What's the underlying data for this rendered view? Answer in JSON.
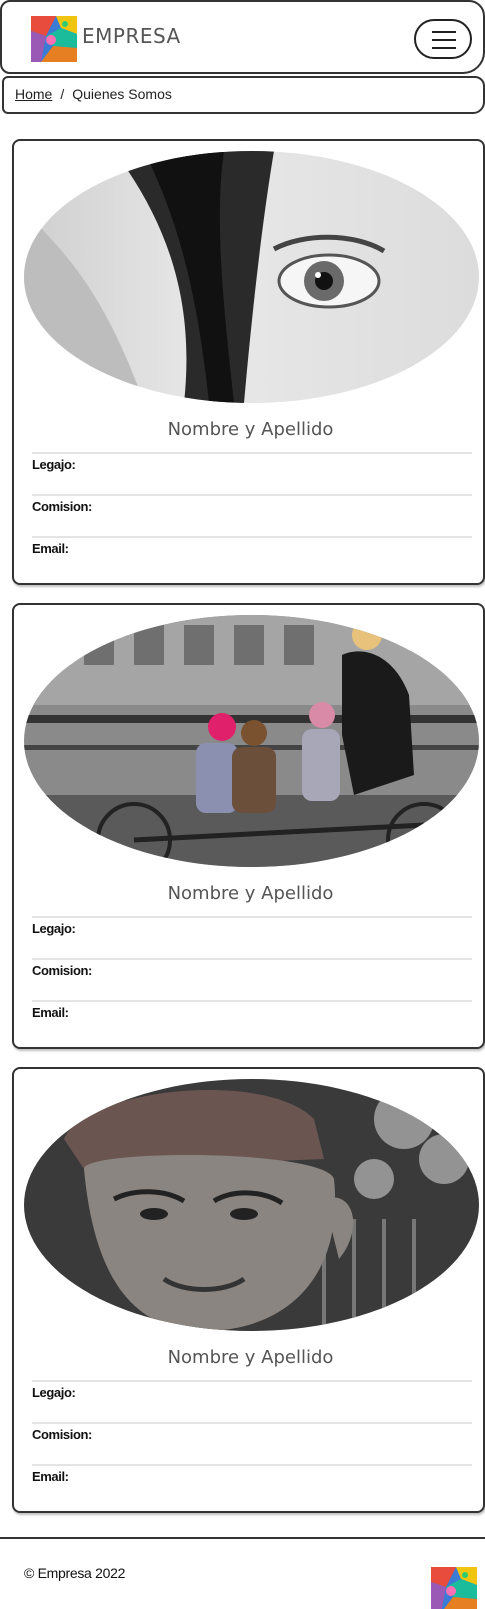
{
  "navbar": {
    "brand_name": "EMPRESA",
    "logo_icon": "abstract-paint-logo",
    "menu_icon": "hamburger-menu-icon"
  },
  "breadcrumb": {
    "home_label": "Home",
    "separator": "/",
    "current_label": "Quienes Somos"
  },
  "team": [
    {
      "name": "Nombre y Apellido",
      "photo": "woman-eye-closeup-grayscale",
      "fields": [
        "Legajo:",
        "Comision:",
        "Email:"
      ]
    },
    {
      "name": "Nombre y Apellido",
      "photo": "woman-children-tandem-bike",
      "fields": [
        "Legajo:",
        "Comision:",
        "Email:"
      ]
    },
    {
      "name": "Nombre y Apellido",
      "photo": "elderly-man-cap-portrait",
      "fields": [
        "Legajo:",
        "Comision:",
        "Email:"
      ]
    }
  ],
  "footer": {
    "copyright": "© Empresa 2022",
    "logo_icon": "abstract-paint-logo"
  },
  "colors": {
    "border": "#333333",
    "divider": "#e4e4e4",
    "name_text": "#555555"
  }
}
